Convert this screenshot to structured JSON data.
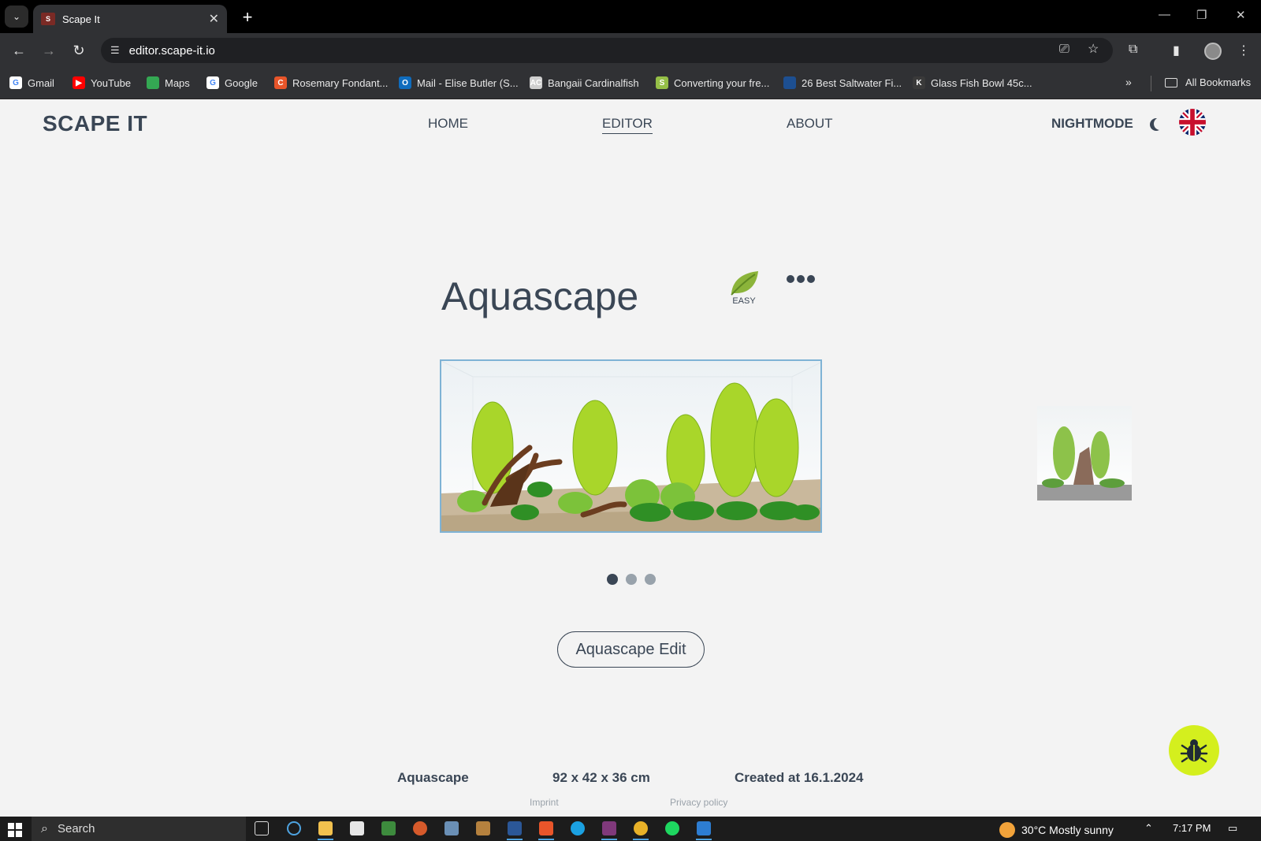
{
  "browser": {
    "tab_title": "Scape It",
    "favicon_text": "S",
    "url": "editor.scape-it.io",
    "bookmarks": [
      {
        "label": "Gmail",
        "color": "#ffffff"
      },
      {
        "label": "YouTube",
        "color": "#ff0000"
      },
      {
        "label": "Maps",
        "color": "#34a853"
      },
      {
        "label": "Google",
        "color": "#ffffff"
      },
      {
        "label": "Rosemary Fondant...",
        "color": "#e8552a"
      },
      {
        "label": "Mail - Elise Butler (S...",
        "color": "#0f6cbd"
      },
      {
        "label": "Bangaii Cardinalfish",
        "color": "#cfcfcf"
      },
      {
        "label": "Converting your fre...",
        "color": "#95bf47"
      },
      {
        "label": "26 Best Saltwater Fi...",
        "color": "#1d4f91"
      },
      {
        "label": "Glass Fish Bowl 45c...",
        "color": "#3a3a3a"
      }
    ],
    "bookmark_icon_letters": [
      "G",
      "▶",
      "",
      "G",
      "C",
      "O",
      "AC",
      "S",
      "",
      "K"
    ],
    "more_bookmarks": "»",
    "all_bookmarks": "All Bookmarks"
  },
  "app": {
    "logo": "SCAPE IT",
    "nav": [
      {
        "label": "HOME"
      },
      {
        "label": "EDITOR"
      },
      {
        "label": "ABOUT"
      }
    ],
    "nightmode_label": "NIGHTMODE",
    "scape_title": "Aquascape",
    "difficulty": "EASY",
    "carousel_active_index": 0,
    "carousel_count": 3,
    "edit_button": "Aquascape Edit",
    "info": {
      "name": "Aquascape",
      "dimensions": "92 x 42 x 36 cm",
      "created": "Created at 16.1.2024"
    },
    "footer": {
      "imprint": "Imprint",
      "privacy": "Privacy policy"
    },
    "colors": {
      "text": "#3a4655",
      "bug_button": "#d4ef1e",
      "plant": "#9bd420"
    }
  },
  "taskbar": {
    "search_placeholder": "Search",
    "weather": "30°C  Mostly sunny",
    "time": "7:17 PM"
  }
}
